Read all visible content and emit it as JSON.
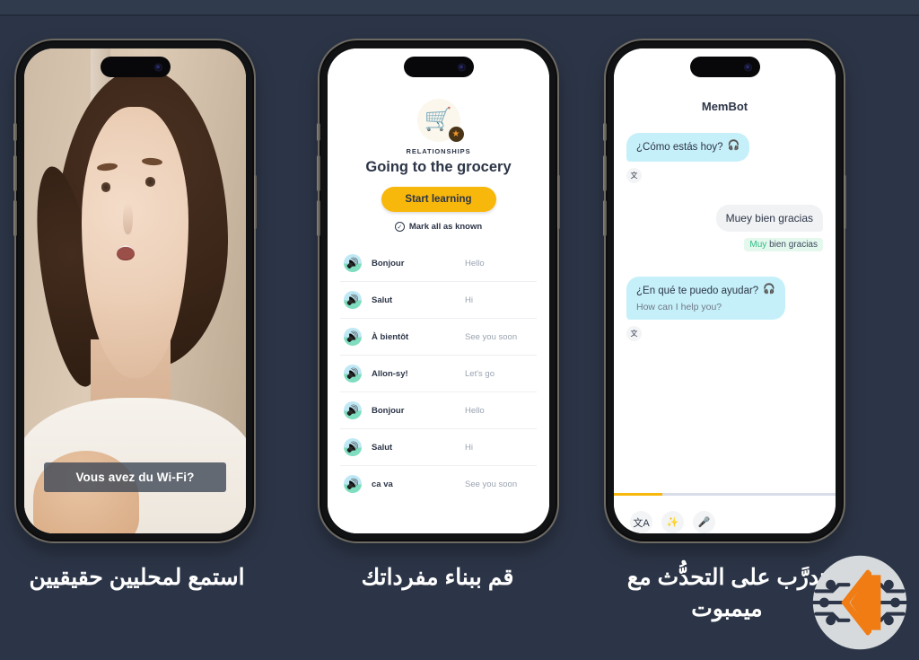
{
  "background_color": "#2c3547",
  "accent_color": "#f8b70b",
  "bot_bubble_color": "#c6f0f9",
  "panels": [
    {
      "id": "video-panel",
      "caption": "استمع لمحليين حقيقيين",
      "subtitle": "Vous avez du Wi-Fi?"
    },
    {
      "id": "lesson-panel",
      "caption": "قم ببناء مفرداتك",
      "category_icon": "shopping-cart-icon",
      "badge_icon": "star-icon",
      "kicker": "RELATIONSHIPS",
      "title": "Going to the grocery",
      "start_button": "Start learning",
      "mark_all": "Mark all as known",
      "words": [
        {
          "source": "Bonjour",
          "target": "Hello"
        },
        {
          "source": "Salut",
          "target": "Hi"
        },
        {
          "source": "À bientôt",
          "target": "See you soon"
        },
        {
          "source": "Allon-sy!",
          "target": "Let's go"
        },
        {
          "source": "Bonjour",
          "target": "Hello"
        },
        {
          "source": "Salut",
          "target": "Hi"
        },
        {
          "source": "ca va",
          "target": "See you soon"
        }
      ]
    },
    {
      "id": "chat-panel",
      "caption": "تدرَّب على التحدُّث مع ميمبوت",
      "title": "MemBot",
      "messages": [
        {
          "from": "bot",
          "text": "¿Cómo estás hoy?"
        },
        {
          "from": "user",
          "text": "Muey bien gracias",
          "correction_wrong": "Muy",
          "correction_rest": " bien gracias"
        },
        {
          "from": "bot",
          "text": "¿En qué te puedo ayudar?",
          "translation": "How can I help you?"
        }
      ],
      "progress_percent": 22,
      "toolbar": [
        {
          "name": "translate-icon",
          "glyph": "文A"
        },
        {
          "name": "magic-wand-icon",
          "glyph": "✨"
        },
        {
          "name": "microphone-icon",
          "glyph": "🎤"
        }
      ]
    }
  ]
}
